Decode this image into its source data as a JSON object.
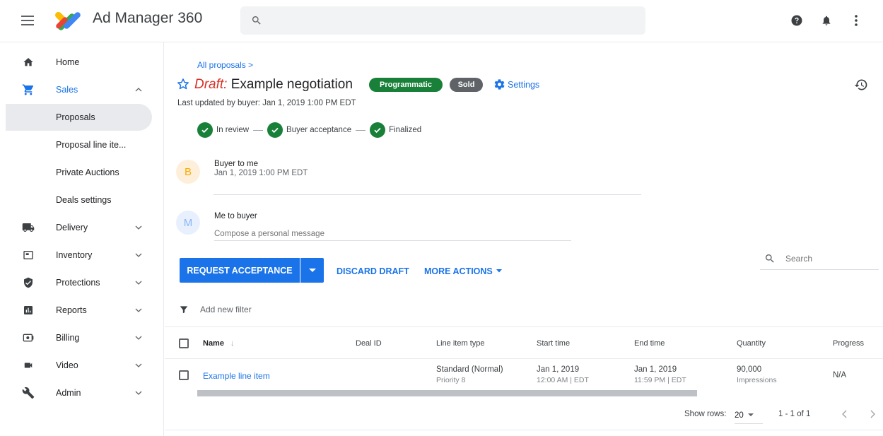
{
  "app": {
    "title": "Ad Manager 360"
  },
  "search": {
    "placeholder": ""
  },
  "colors": {
    "accent": "#1a73e8",
    "programmatic": "#188038",
    "sold": "#5f6368",
    "draft": "#d93025",
    "buyer_avatar": "#f9ab00"
  },
  "top_icons": [
    "help-icon",
    "notifications-icon",
    "more-vert-icon"
  ],
  "sidebar": {
    "items": [
      {
        "label": "Home",
        "icon": "home-icon"
      },
      {
        "label": "Sales",
        "icon": "cart-icon",
        "expanded": true
      },
      {
        "label": "Delivery",
        "icon": "truck-icon"
      },
      {
        "label": "Inventory",
        "icon": "inventory-icon"
      },
      {
        "label": "Protections",
        "icon": "shield-icon"
      },
      {
        "label": "Reports",
        "icon": "reports-icon"
      },
      {
        "label": "Billing",
        "icon": "billing-icon"
      },
      {
        "label": "Video",
        "icon": "video-icon"
      },
      {
        "label": "Admin",
        "icon": "wrench-icon"
      }
    ],
    "sales_sub": [
      {
        "label": "Proposals",
        "selected": true
      },
      {
        "label": "Proposal line ite..."
      },
      {
        "label": "Private Auctions"
      },
      {
        "label": "Deals settings"
      }
    ]
  },
  "page": {
    "breadcrumb": "All proposals >",
    "draft_label": "Draft:",
    "title": "Example negotiation",
    "badges": {
      "programmatic": "Programmatic",
      "sold": "Sold"
    },
    "settings_label": "Settings",
    "updated": "Last updated by buyer: Jan 1, 2019 1:00 PM EDT",
    "steps": [
      "In review",
      "Buyer acceptance",
      "Finalized"
    ]
  },
  "messages": {
    "buyer": {
      "initial": "B",
      "title": "Buyer to me",
      "time": "Jan 1, 2019 1:00 PM EDT"
    },
    "me": {
      "initial": "M",
      "title": "Me to buyer",
      "placeholder": "Compose a personal message"
    }
  },
  "actions": {
    "request": "REQUEST ACCEPTANCE",
    "discard": "DISCARD DRAFT",
    "more": "MORE ACTIONS",
    "search_placeholder": "Search",
    "filter": "Add new filter"
  },
  "table": {
    "columns": [
      "Name",
      "Deal ID",
      "Line item type",
      "Start time",
      "End time",
      "Quantity",
      "Progress"
    ],
    "rows": [
      {
        "name": "Example line item",
        "deal_id": "",
        "type": "Standard (Normal)",
        "type_sub": "Priority 8",
        "start": "Jan 1, 2019",
        "start_sub": "12:00 AM | EDT",
        "end": "Jan 1, 2019",
        "end_sub": "11:59 PM | EDT",
        "quantity": "90,000",
        "quantity_sub": "Impressions",
        "progress": "N/A"
      }
    ],
    "footer": {
      "show_rows_label": "Show rows:",
      "rows_value": "20",
      "range": "1 - 1 of 1"
    }
  }
}
